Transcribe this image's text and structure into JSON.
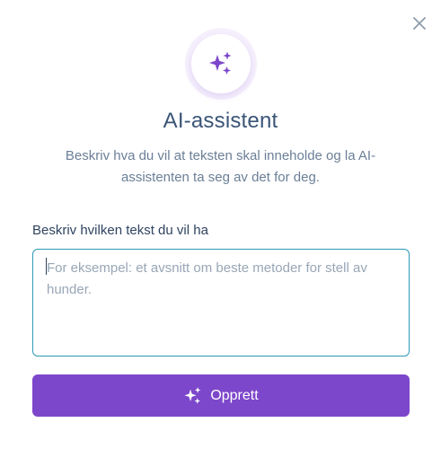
{
  "dialog": {
    "close_icon": "close-icon",
    "hero_icon": "sparkles-icon",
    "title": "AI-assistent",
    "subtitle": "Beskriv hva du vil at teksten skal inneholde og la AI-assistenten ta seg av det for deg.",
    "field": {
      "label": "Beskriv hvilken tekst du vil ha",
      "value": "",
      "placeholder": "For eksempel: et avsnitt om beste metoder for stell av hunder."
    },
    "create_button": {
      "label": "Opprett",
      "icon": "sparkles-icon"
    }
  },
  "colors": {
    "accent": "#7d47cb",
    "accent_light": "#f6f1fd",
    "title": "#3a5577",
    "body_text": "#6b7f97",
    "field_border": "#2c9ab7",
    "placeholder": "#98a6b6",
    "close_icon": "#8e9cab"
  }
}
